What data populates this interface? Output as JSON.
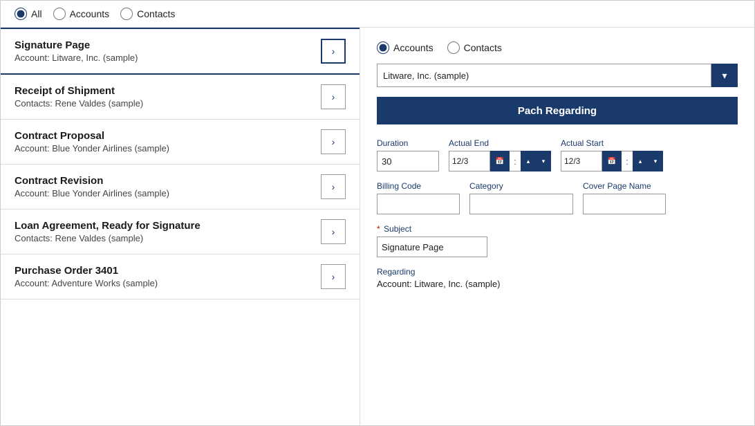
{
  "top_bar": {
    "radio_all_label": "All",
    "radio_accounts_label": "Accounts",
    "radio_contacts_label": "Contacts",
    "selected": "all"
  },
  "list": {
    "items": [
      {
        "title": "Signature Page",
        "sub": "Account: Litware, Inc. (sample)",
        "selected": true
      },
      {
        "title": "Receipt of Shipment",
        "sub": "Contacts: Rene Valdes (sample)",
        "selected": false
      },
      {
        "title": "Contract Proposal",
        "sub": "Account: Blue Yonder Airlines (sample)",
        "selected": false
      },
      {
        "title": "Contract Revision",
        "sub": "Account: Blue Yonder Airlines (sample)",
        "selected": false
      },
      {
        "title": "Loan Agreement, Ready for Signature",
        "sub": "Contacts: Rene Valdes (sample)",
        "selected": false
      },
      {
        "title": "Purchase Order 3401",
        "sub": "Account: Adventure Works (sample)",
        "selected": false
      }
    ]
  },
  "right_panel": {
    "radio_accounts_label": "Accounts",
    "radio_contacts_label": "Contacts",
    "selected": "accounts",
    "dropdown_value": "Litware, Inc. (sample)",
    "patch_button_label": "Pach Regarding",
    "duration_label": "Duration",
    "duration_value": "30",
    "actual_end_label": "Actual End",
    "actual_end_value": "12/3",
    "actual_start_label": "Actual Start",
    "actual_start_value": "12/3",
    "billing_code_label": "Billing Code",
    "billing_code_value": "",
    "category_label": "Category",
    "category_value": "",
    "cover_page_name_label": "Cover Page Name",
    "cover_page_name_value": "",
    "subject_label": "Subject",
    "subject_required": true,
    "subject_value": "Signature Page",
    "regarding_label": "Regarding",
    "regarding_value": "Account: Litware, Inc. (sample)"
  },
  "icons": {
    "chevron_right": "›",
    "chevron_down": "∨",
    "calendar": "📅",
    "dropdown_arrow": "▾"
  }
}
